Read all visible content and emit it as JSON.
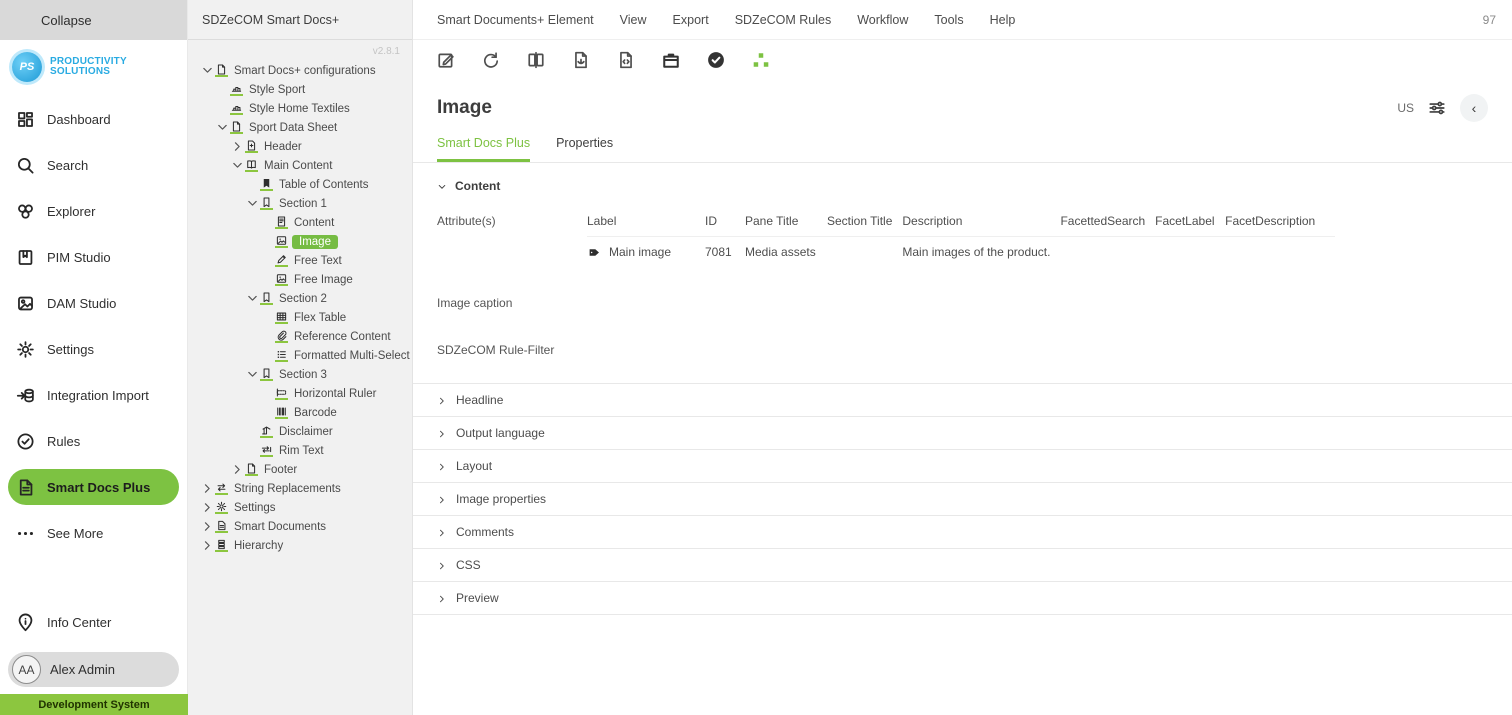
{
  "sidebar": {
    "collapse_label": "Collapse",
    "logo": {
      "initials": "PS",
      "line1": "PRODUCTIVITY",
      "line2": "SOLUTIONS"
    },
    "items": [
      {
        "icon": "dashboard-icon",
        "label": "Dashboard",
        "active": false
      },
      {
        "icon": "search-icon",
        "label": "Search",
        "active": false
      },
      {
        "icon": "explorer-icon",
        "label": "Explorer",
        "active": false
      },
      {
        "icon": "pim-studio-icon",
        "label": "PIM Studio",
        "active": false
      },
      {
        "icon": "dam-studio-icon",
        "label": "DAM Studio",
        "active": false
      },
      {
        "icon": "settings-icon",
        "label": "Settings",
        "active": false
      },
      {
        "icon": "integration-import-icon",
        "label": "Integration Import",
        "active": false
      },
      {
        "icon": "rules-icon",
        "label": "Rules",
        "active": false
      },
      {
        "icon": "smart-docs-plus-icon",
        "label": "Smart Docs Plus",
        "active": true
      },
      {
        "icon": "see-more-icon",
        "label": "See More",
        "active": false
      }
    ],
    "info_center_label": "Info Center",
    "user": {
      "initials": "AA",
      "name": "Alex Admin"
    },
    "environment": "Development System"
  },
  "tree_panel": {
    "title": "SDZeCOM Smart Docs+",
    "version": "v2.8.1",
    "items": [
      {
        "level": 0,
        "chevron": "down",
        "icon": "pdf-doc-icon",
        "label": "Smart Docs+ configurations",
        "selected": false
      },
      {
        "level": 1,
        "chevron": "none",
        "icon": "style-icon",
        "label": "Style Sport",
        "selected": false
      },
      {
        "level": 1,
        "chevron": "none",
        "icon": "style-icon",
        "label": "Style Home Textiles",
        "selected": false
      },
      {
        "level": 1,
        "chevron": "down",
        "icon": "pdf-doc-icon",
        "label": "Sport Data Sheet",
        "selected": false
      },
      {
        "level": 2,
        "chevron": "right",
        "icon": "doc-plus-icon",
        "label": "Header",
        "selected": false
      },
      {
        "level": 2,
        "chevron": "down",
        "icon": "book-icon",
        "label": "Main Content",
        "selected": false
      },
      {
        "level": 3,
        "chevron": "none",
        "icon": "bookmark-icon",
        "label": "Table of Contents",
        "selected": false
      },
      {
        "level": 3,
        "chevron": "down",
        "icon": "section-icon",
        "label": "Section 1",
        "selected": false
      },
      {
        "level": 4,
        "chevron": "none",
        "icon": "content-doc-icon",
        "label": "Content",
        "selected": false
      },
      {
        "level": 4,
        "chevron": "none",
        "icon": "image-icon",
        "label": "Image",
        "selected": true
      },
      {
        "level": 4,
        "chevron": "none",
        "icon": "pen-icon",
        "label": "Free Text",
        "selected": false
      },
      {
        "level": 4,
        "chevron": "none",
        "icon": "image-icon",
        "label": "Free Image",
        "selected": false
      },
      {
        "level": 3,
        "chevron": "down",
        "icon": "section-icon",
        "label": "Section 2",
        "selected": false
      },
      {
        "level": 4,
        "chevron": "none",
        "icon": "table-icon",
        "label": "Flex Table",
        "selected": false
      },
      {
        "level": 4,
        "chevron": "none",
        "icon": "paperclip-icon",
        "label": "Reference Content",
        "selected": false
      },
      {
        "level": 4,
        "chevron": "none",
        "icon": "list-icon",
        "label": "Formatted Multi-Select",
        "selected": false
      },
      {
        "level": 3,
        "chevron": "down",
        "icon": "section-icon",
        "label": "Section 3",
        "selected": false
      },
      {
        "level": 4,
        "chevron": "none",
        "icon": "ruler-icon",
        "label": "Horizontal Ruler",
        "selected": false
      },
      {
        "level": 4,
        "chevron": "none",
        "icon": "barcode-icon",
        "label": "Barcode",
        "selected": false
      },
      {
        "level": 3,
        "chevron": "none",
        "icon": "disclaimer-icon",
        "label": "Disclaimer",
        "selected": false
      },
      {
        "level": 3,
        "chevron": "none",
        "icon": "rim-text-icon",
        "label": "Rim Text",
        "selected": false
      },
      {
        "level": 2,
        "chevron": "right",
        "icon": "doc-footer-icon",
        "label": "Footer",
        "selected": false
      },
      {
        "level": 0,
        "chevron": "right",
        "icon": "swap-icon",
        "label": "String Replacements",
        "selected": false
      },
      {
        "level": 0,
        "chevron": "right",
        "icon": "gear-icon",
        "label": "Settings",
        "selected": false
      },
      {
        "level": 0,
        "chevron": "right",
        "icon": "smart-doc-icon",
        "label": "Smart Documents",
        "selected": false
      },
      {
        "level": 0,
        "chevron": "right",
        "icon": "hierarchy-icon",
        "label": "Hierarchy",
        "selected": false
      }
    ]
  },
  "menubar": {
    "items": [
      "Smart Documents+ Element",
      "View",
      "Export",
      "SDZeCOM Rules",
      "Workflow",
      "Tools",
      "Help"
    ],
    "badge": "97"
  },
  "toolbar": {
    "icons": [
      {
        "name": "edit-icon",
        "tone": "normal"
      },
      {
        "name": "refresh-icon",
        "tone": "normal"
      },
      {
        "name": "compare-book-icon",
        "tone": "normal"
      },
      {
        "name": "pdf-export-icon",
        "tone": "normal"
      },
      {
        "name": "code-doc-icon",
        "tone": "normal"
      },
      {
        "name": "briefcase-icon",
        "tone": "dark"
      },
      {
        "name": "check-circle-icon",
        "tone": "dark"
      },
      {
        "name": "sitemap-icon",
        "tone": "green"
      }
    ]
  },
  "detail": {
    "title": "Image",
    "locale": "US",
    "tabs": [
      {
        "label": "Smart Docs Plus",
        "active": true
      },
      {
        "label": "Properties",
        "active": false
      }
    ],
    "content_section": {
      "label": "Content",
      "attributes_label": "Attribute(s)",
      "table": {
        "headers": [
          "Label",
          "ID",
          "Pane Title",
          "Section Title",
          "Description",
          "FacettedSearch",
          "FacetLabel",
          "FacetDescription"
        ],
        "rows": [
          [
            "Main image",
            "7081",
            "Media assets",
            "",
            "Main images of the product.",
            "",
            "",
            ""
          ]
        ]
      },
      "fields": [
        "Image caption",
        "SDZeCOM Rule-Filter"
      ]
    },
    "collapsed_sections": [
      "Headline",
      "Output language",
      "Layout",
      "Image properties",
      "Comments",
      "CSS",
      "Preview"
    ]
  },
  "colors": {
    "accent_green": "#7dc242",
    "env_green": "#8cc63f",
    "logo_blue": "#29abe2"
  }
}
